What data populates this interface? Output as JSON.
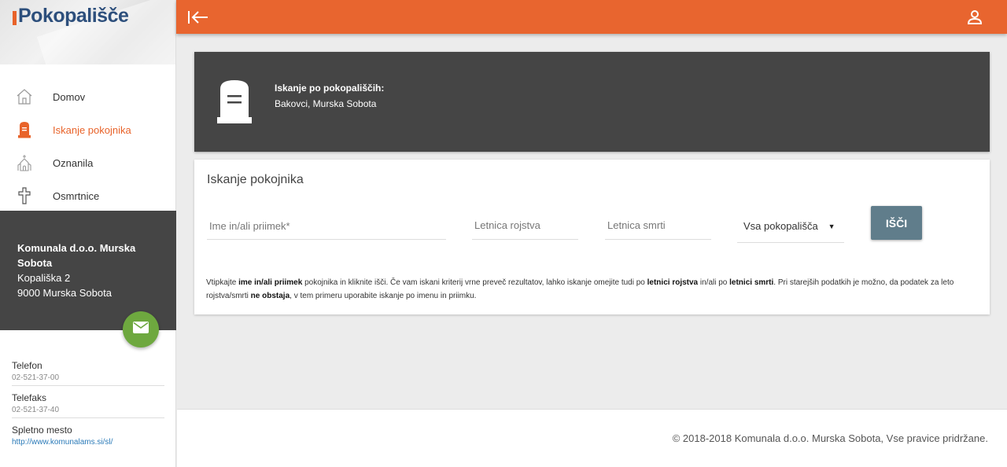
{
  "brand": {
    "logo_text": "Pokopališče",
    "accent": "#e8652f",
    "dark": "#454545"
  },
  "nav": {
    "items": [
      {
        "label": "Domov",
        "icon": "home-icon",
        "active": false
      },
      {
        "label": "Iskanje pokojnika",
        "icon": "tombstone-icon",
        "active": true
      },
      {
        "label": "Oznanila",
        "icon": "church-icon",
        "active": false
      },
      {
        "label": "Osmrtnice",
        "icon": "cross-icon",
        "active": false
      }
    ]
  },
  "company": {
    "name": "Komunala d.o.o. Murska Sobota",
    "street": "Kopališka 2",
    "city": "9000  Murska Sobota"
  },
  "contacts": {
    "phone_label": "Telefon",
    "phone_value": "02-521-37-00",
    "fax_label": "Telefaks",
    "fax_value": "02-521-37-40",
    "web_label": "Spletno mesto",
    "web_value": "http://www.komunalams.si/sl/"
  },
  "hero": {
    "title": "Iskanje po pokopališčih:",
    "subtitle": "Bakovci, Murska Sobota"
  },
  "search": {
    "title": "Iskanje pokojnika",
    "name_placeholder": "Ime in/ali priimek*",
    "born_placeholder": "Letnica rojstva",
    "died_placeholder": "Letnica smrti",
    "cemetery_selected": "Vsa pokopališča",
    "button_label": "IŠČI",
    "help": {
      "p1": "Vtipkajte ",
      "b1": "ime in/ali priimek",
      "p2": " pokojnika in kliknite išči. Če vam iskani kriterij vrne preveč rezultatov, lahko iskanje omejite tudi po ",
      "b2": "letnici rojstva",
      "p3": " in/ali po ",
      "b3": "letnici smrti",
      "p4": ". Pri starejših podatkih je možno, da podatek za leto rojstva/smrti ",
      "b4": "ne obstaja",
      "p5": ", v tem primeru uporabite iskanje po imenu in priimku."
    }
  },
  "footer": {
    "copyright": "© 2018-2018  Komunala d.o.o. Murska Sobota, Vse pravice pridržane."
  }
}
